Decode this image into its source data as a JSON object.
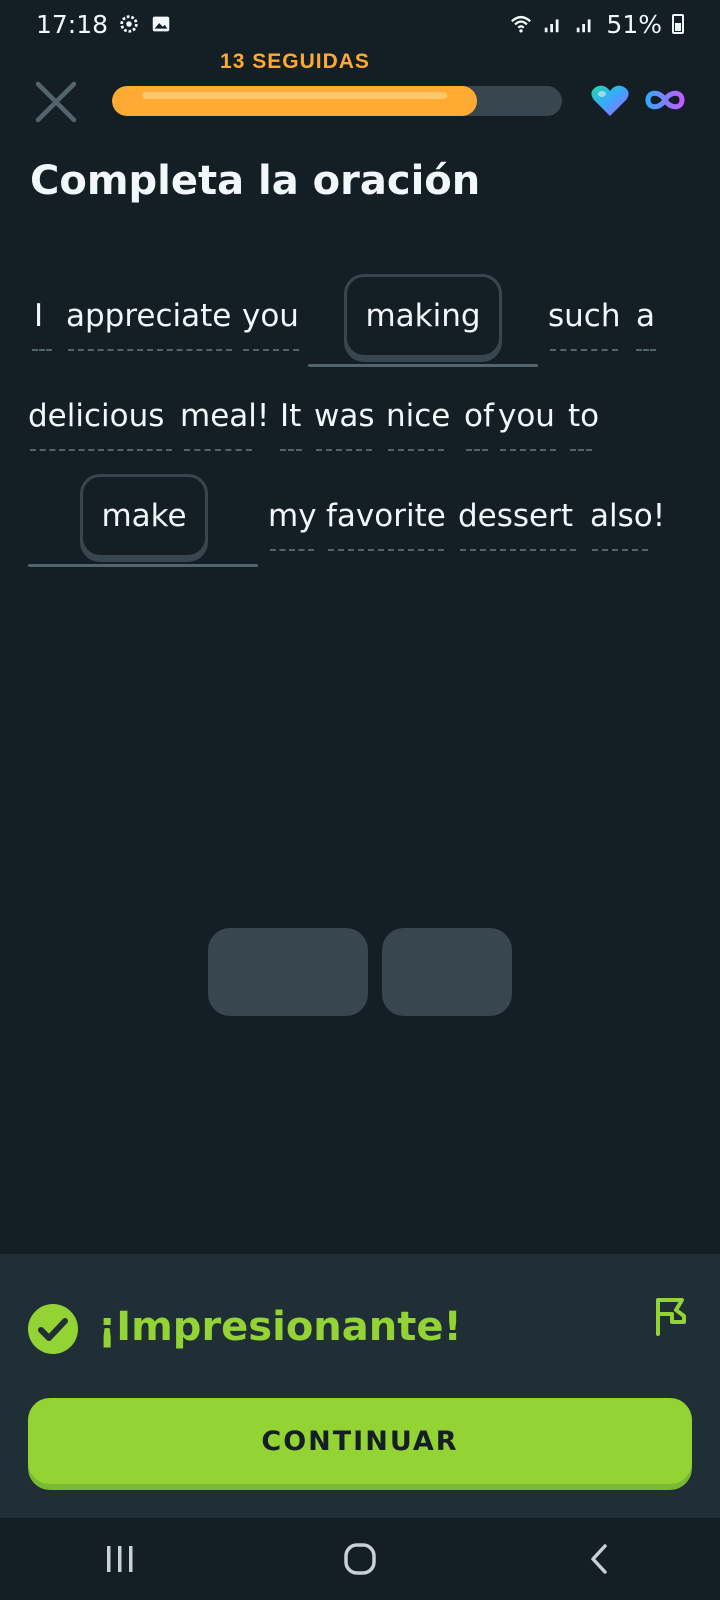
{
  "status_bar": {
    "time": "17:18",
    "battery": "51%",
    "icons": [
      "settings-icon",
      "image-icon",
      "wifi-icon",
      "signal-icon",
      "signal-icon",
      "battery-icon"
    ]
  },
  "header": {
    "streak_label": "13 SEGUIDAS",
    "progress": 0.81,
    "icons": [
      "close-icon",
      "heart-icon",
      "infinity-icon"
    ]
  },
  "exercise": {
    "title": "Completa la oración",
    "sentence_words": [
      "I",
      "appreciate",
      "you",
      "such",
      "a",
      "delicious",
      "meal!",
      "It",
      "was",
      "nice",
      "of",
      "you",
      "to",
      "my",
      "favorite",
      "dessert",
      "also!"
    ],
    "answers": [
      "making",
      "make"
    ]
  },
  "feedback": {
    "message": "¡Impresionante!",
    "continue_label": "CONTINUAR",
    "icons": [
      "check-icon",
      "flag-icon"
    ]
  },
  "nav_bar": {
    "icons": [
      "recent-apps-icon",
      "home-icon",
      "back-icon"
    ]
  },
  "colors": {
    "background": "#131f24",
    "accent_orange": "#ffab33",
    "success_green": "#93d333",
    "chip_border": "#37464f"
  }
}
